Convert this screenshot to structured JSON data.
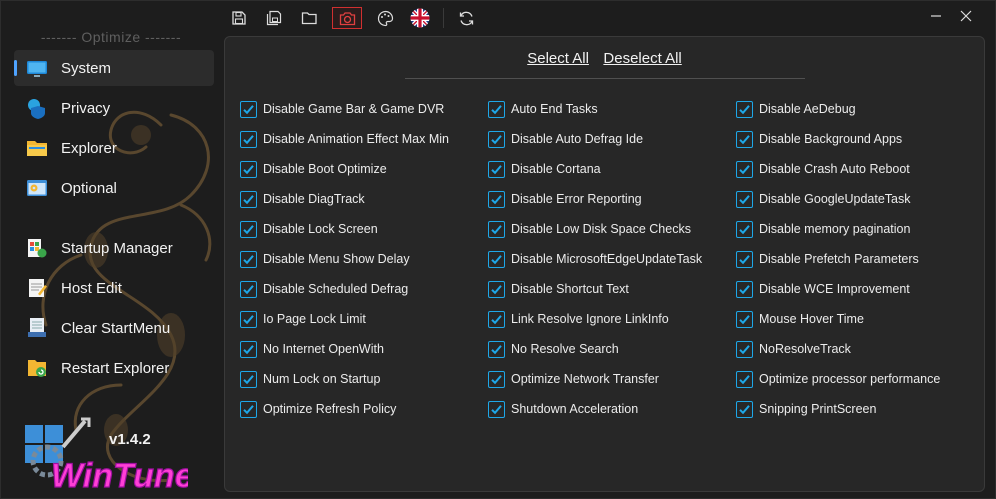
{
  "sidebar": {
    "title": "------- Optimize -------",
    "items": [
      {
        "label": "System",
        "active": true
      },
      {
        "label": "Privacy"
      },
      {
        "label": "Explorer"
      },
      {
        "label": "Optional"
      }
    ],
    "tools": [
      {
        "label": "Startup Manager"
      },
      {
        "label": "Host Edit"
      },
      {
        "label": "Clear StartMenu"
      },
      {
        "label": "Restart Explorer"
      }
    ],
    "version": "v1.4.2",
    "logo_text": "WinTune"
  },
  "toolbar": {
    "icons": [
      "save-icon",
      "save-all-icon",
      "folder-open-icon",
      "camera-icon",
      "palette-icon",
      "uk-flag-icon",
      "refresh-icon"
    ]
  },
  "colors": {
    "accent": "#1ea7e8",
    "active_border": "#d03030",
    "indicator": "#4fa3ff"
  },
  "panel": {
    "select_all": "Select All",
    "deselect_all": "Deselect All",
    "options": [
      {
        "label": "Disable Game Bar & Game DVR",
        "checked": true
      },
      {
        "label": "Auto End Tasks",
        "checked": true
      },
      {
        "label": "Disable AeDebug",
        "checked": true
      },
      {
        "label": "Disable Animation Effect Max Min",
        "checked": true
      },
      {
        "label": "Disable Auto Defrag Ide",
        "checked": true
      },
      {
        "label": "Disable Background Apps",
        "checked": true
      },
      {
        "label": "Disable Boot Optimize",
        "checked": true
      },
      {
        "label": "Disable Cortana",
        "checked": true
      },
      {
        "label": "Disable Crash Auto Reboot",
        "checked": true
      },
      {
        "label": "Disable DiagTrack",
        "checked": true
      },
      {
        "label": "Disable Error Reporting",
        "checked": true
      },
      {
        "label": "Disable GoogleUpdateTask",
        "checked": true
      },
      {
        "label": "Disable Lock Screen",
        "checked": true
      },
      {
        "label": "Disable Low Disk Space Checks",
        "checked": true
      },
      {
        "label": "Disable memory pagination",
        "checked": true
      },
      {
        "label": "Disable Menu Show Delay",
        "checked": true
      },
      {
        "label": "Disable MicrosoftEdgeUpdateTask",
        "checked": true
      },
      {
        "label": "Disable Prefetch Parameters",
        "checked": true
      },
      {
        "label": "Disable Scheduled Defrag",
        "checked": true
      },
      {
        "label": "Disable Shortcut Text",
        "checked": true
      },
      {
        "label": "Disable WCE Improvement",
        "checked": true
      },
      {
        "label": "Io Page Lock Limit",
        "checked": true
      },
      {
        "label": "Link Resolve Ignore LinkInfo",
        "checked": true
      },
      {
        "label": "Mouse Hover Time",
        "checked": true
      },
      {
        "label": "No Internet OpenWith",
        "checked": true
      },
      {
        "label": "No Resolve Search",
        "checked": true
      },
      {
        "label": "NoResolveTrack",
        "checked": true
      },
      {
        "label": "Num Lock on Startup",
        "checked": true
      },
      {
        "label": "Optimize Network Transfer",
        "checked": true
      },
      {
        "label": "Optimize processor performance",
        "checked": true
      },
      {
        "label": "Optimize Refresh Policy",
        "checked": true
      },
      {
        "label": "Shutdown Acceleration",
        "checked": true
      },
      {
        "label": "Snipping PrintScreen",
        "checked": true
      }
    ]
  }
}
